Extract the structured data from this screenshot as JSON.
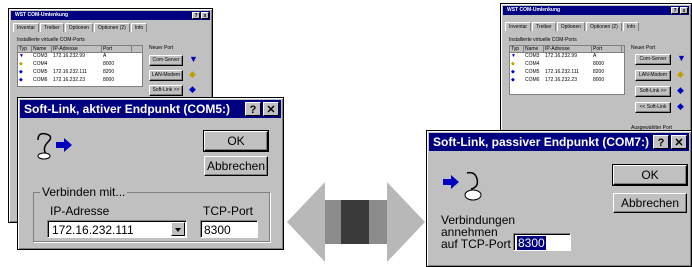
{
  "left_back_window": {
    "title": "WST COM-Umlenkung",
    "tabs": [
      "Inventar",
      "Treiber",
      "Optionen",
      "Optionen (2)",
      "Info"
    ],
    "section_label": "Installierte virtuelle COM-Ports",
    "columns": [
      "Typ",
      "Name",
      "IP-Adresse",
      "Port"
    ],
    "rows": [
      {
        "name": "COM3",
        "ip": "172.16.232.99",
        "port": "A"
      },
      {
        "name": "COM4",
        "ip": "",
        "port": "8000"
      },
      {
        "name": "COM5",
        "ip": "172.16.232.111",
        "port": "8200"
      },
      {
        "name": "COM6",
        "ip": "172.16.232.23",
        "port": "8000"
      }
    ],
    "new_port_label": "Neuer Port",
    "buttons": [
      "Com-Server",
      "LAN-Modem",
      "Soft-Link >>"
    ]
  },
  "right_back_window": {
    "title": "WST COM-Umlenkung",
    "tabs": [
      "Inventar",
      "Treiber",
      "Optionen",
      "Optionen (2)",
      "Info"
    ],
    "section_label": "Installierte virtuelle COM-Ports",
    "columns": [
      "Typ",
      "Name",
      "IP-Adresse",
      "Port"
    ],
    "rows": [
      {
        "name": "COM3",
        "ip": "172.16.232.99",
        "port": "A"
      },
      {
        "name": "COM4",
        "ip": "",
        "port": "8000"
      },
      {
        "name": "COM5",
        "ip": "172.16.232.111",
        "port": "8200"
      },
      {
        "name": "COM6",
        "ip": "172.16.232.23",
        "port": "8000"
      }
    ],
    "new_port_label": "Neuer Port",
    "buttons": [
      "Com-Server",
      "LAN-Modem",
      "Soft-Link >>",
      "<< Soft-Link"
    ],
    "selected_port_label": "Ausgewählter Port"
  },
  "active_dialog": {
    "title": "Soft-Link, aktiver Endpunkt (COM5:)",
    "help_btn": "?",
    "close_btn": "✕",
    "ok": "OK",
    "cancel": "Abbrechen",
    "group_label": "Verbinden mit...",
    "ip_label": "IP-Adresse",
    "ip_value": "172.16.232.111",
    "port_label": "TCP-Port",
    "port_value": "8300"
  },
  "passive_dialog": {
    "title": "Soft-Link, passiver Endpunkt (COM7:)",
    "help_btn": "?",
    "close_btn": "✕",
    "ok": "OK",
    "cancel": "Abbrechen",
    "accept_label_1": "Verbindungen",
    "accept_label_2": "annehmen",
    "accept_label_3": "auf TCP-Port",
    "port_value": "8300"
  },
  "colors": {
    "titlebar": "#000080",
    "face": "#c0c0c0",
    "arrow_light": "#b8b8b8",
    "arrow_dark": "#3a3a3a"
  }
}
